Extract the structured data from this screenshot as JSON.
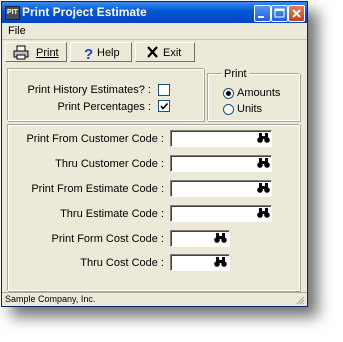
{
  "window": {
    "title": "Print Project Estimate",
    "app_icon_text": "PIT"
  },
  "menu": {
    "file": "File"
  },
  "toolbar": {
    "print_label": "Print",
    "help_label": "Help",
    "exit_label": "Exit"
  },
  "options": {
    "history_label": "Print History Estimates? :",
    "history_checked": false,
    "percentages_label": "Print Percentages :",
    "percentages_checked": true
  },
  "print_group": {
    "legend": "Print",
    "amounts_label": "Amounts",
    "units_label": "Units",
    "selected": "Amounts"
  },
  "codes": {
    "from_customer_label": "Print From Customer Code :",
    "from_customer_value": "",
    "thru_customer_label": "Thru Customer Code :",
    "thru_customer_value": "",
    "from_estimate_label": "Print From Estimate Code :",
    "from_estimate_value": "",
    "thru_estimate_label": "Thru Estimate Code :",
    "thru_estimate_value": "",
    "from_cost_label": "Print Form Cost Code :",
    "from_cost_value": "",
    "thru_cost_label": "Thru Cost Code :",
    "thru_cost_value": ""
  },
  "status": {
    "company": "Sample Company, Inc."
  },
  "icons": {
    "print": "printer-icon",
    "help": "question-mark-icon",
    "exit": "x-icon",
    "find": "binoculars-icon"
  }
}
